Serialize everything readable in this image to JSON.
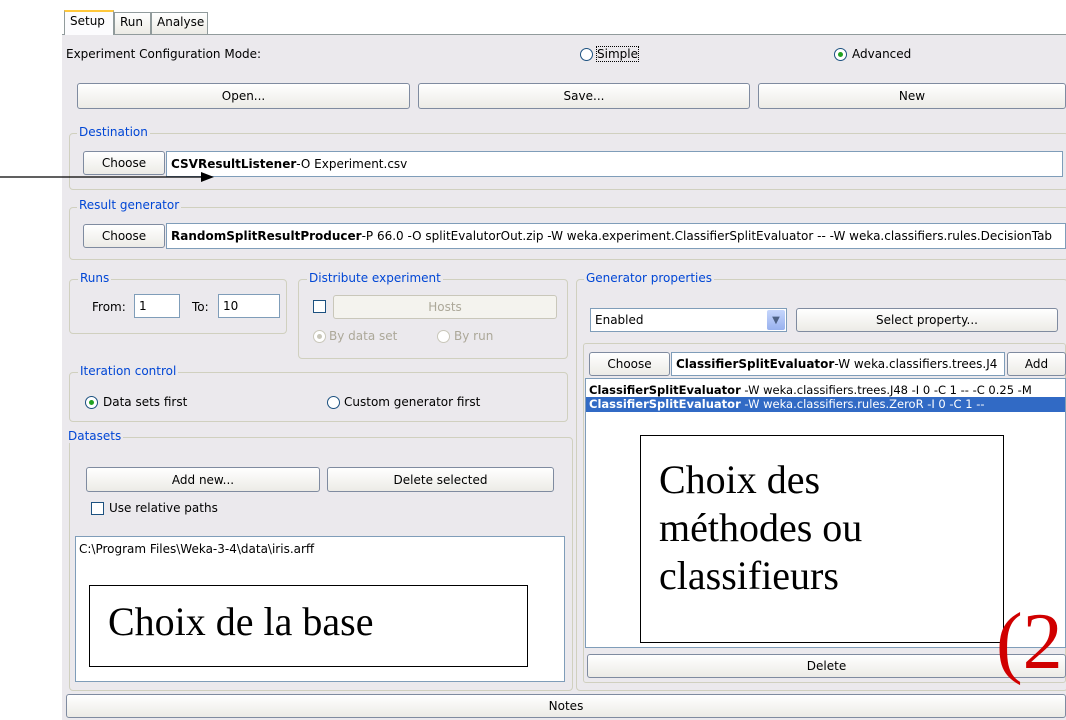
{
  "tabs": [
    "Setup",
    "Run",
    "Analyse"
  ],
  "config_mode": {
    "label": "Experiment Configuration Mode:",
    "simple": "Simple",
    "advanced": "Advanced",
    "selected": "Advanced"
  },
  "top_buttons": {
    "open": "Open...",
    "save": "Save...",
    "new": "New"
  },
  "destination": {
    "title": "Destination",
    "choose": "Choose",
    "class": "CSVResultListener",
    "args": " -O Experiment.csv"
  },
  "result_generator": {
    "title": "Result generator",
    "choose": "Choose",
    "class": "RandomSplitResultProducer",
    "args": " -P 66.0 -O splitEvalutorOut.zip -W weka.experiment.ClassifierSplitEvaluator -- -W weka.classifiers.rules.DecisionTab"
  },
  "runs": {
    "title": "Runs",
    "from_label": "From:",
    "from_value": "1",
    "to_label": "To:",
    "to_value": "10"
  },
  "distribute": {
    "title": "Distribute experiment",
    "hosts": "Hosts",
    "by_data_set": "By data set",
    "by_run": "By run"
  },
  "iteration": {
    "title": "Iteration control",
    "data_sets_first": "Data sets first",
    "custom_first": "Custom generator first"
  },
  "datasets": {
    "title": "Datasets",
    "add_new": "Add new...",
    "delete_selected": "Delete selected",
    "use_relative": "Use relative paths",
    "items": [
      "C:\\Program Files\\Weka-3-4\\data\\iris.arff"
    ]
  },
  "generator_properties": {
    "title": "Generator properties",
    "enabled_value": "Enabled",
    "select_property": "Select property...",
    "choose": "Choose",
    "chosen_class": "ClassifierSplitEvaluator",
    "chosen_args": " -W weka.classifiers.trees.J4",
    "add": "Add",
    "items": [
      {
        "class": "ClassifierSplitEvaluator",
        "args": " -W weka.classifiers.trees.J48 -I 0 -C 1 -- -C 0.25 -M"
      },
      {
        "class": "ClassifierSplitEvaluator",
        "args": " -W weka.classifiers.rules.ZeroR -I 0 -C 1 --"
      }
    ],
    "delete": "Delete"
  },
  "notes": "Notes",
  "annotations": {
    "base_box": "Choix de la base",
    "methods_box_line1": "Choix des",
    "methods_box_line2": "méthodes ou",
    "methods_box_line3": "classifieurs",
    "corner_text": "(2"
  },
  "colors": {
    "panel": "#ebe9ed",
    "selection": "#316ac5",
    "group_title": "#0046d5",
    "corner_text": "#d00000"
  }
}
